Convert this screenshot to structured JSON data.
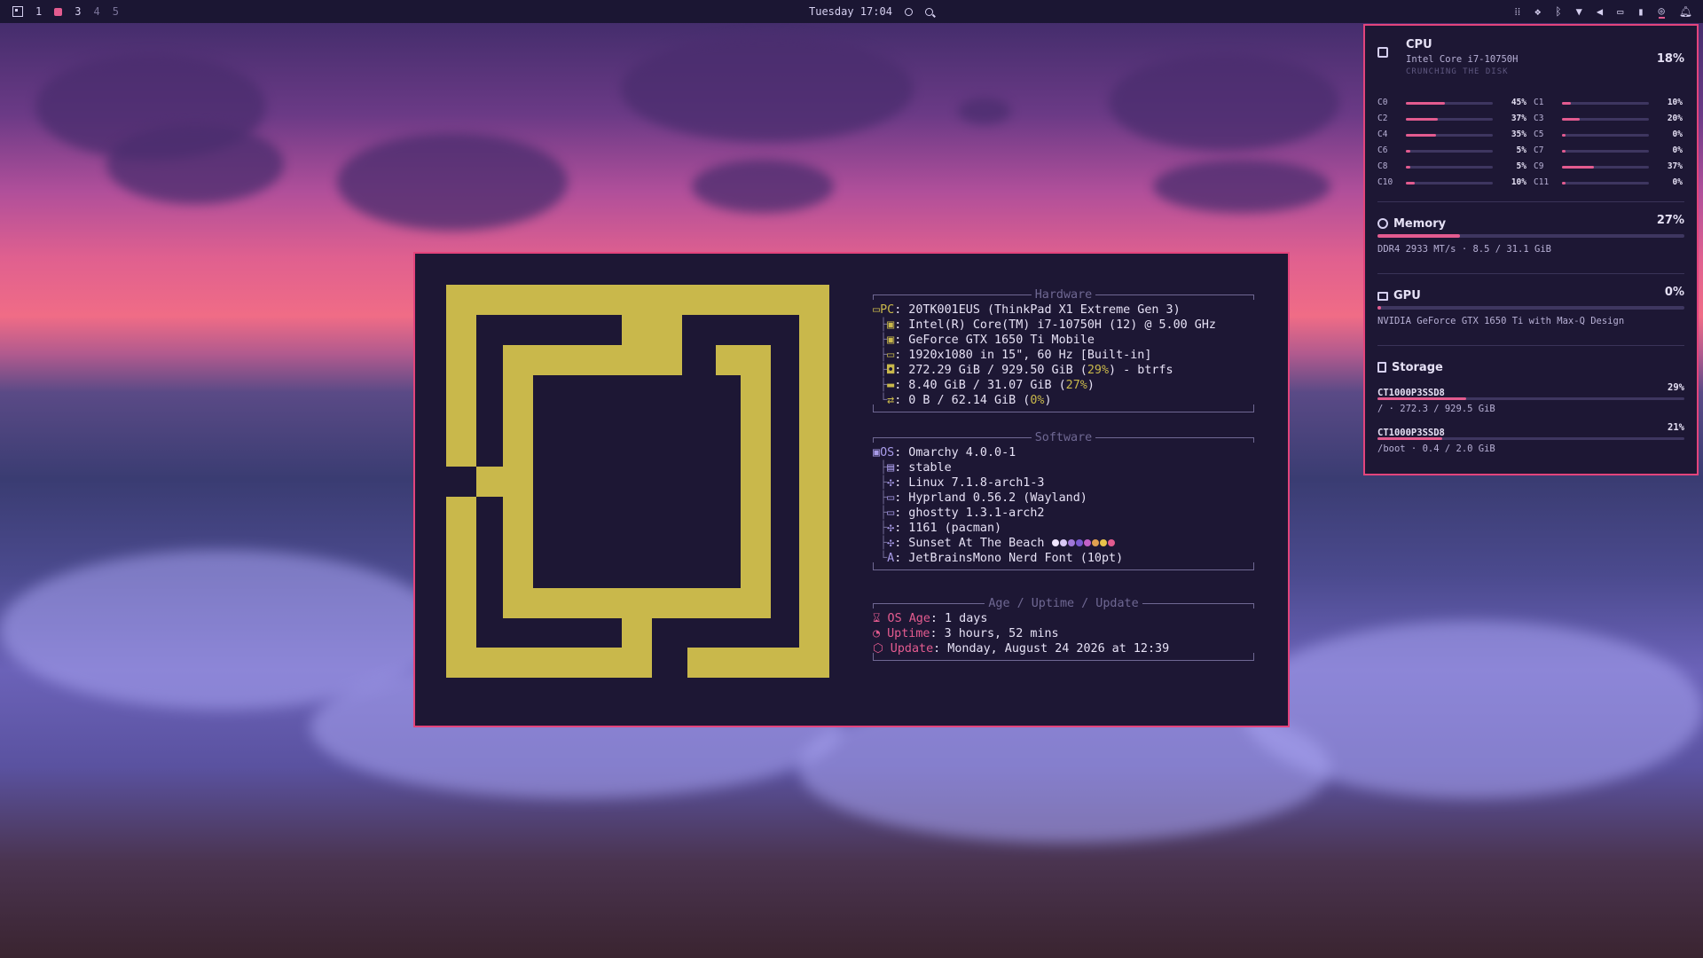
{
  "topbar": {
    "workspaces": [
      "1",
      "3",
      "4",
      "5"
    ],
    "clock": "Tuesday 17:04",
    "tray_icons": [
      "grid-icon",
      "dropbox-icon",
      "bluetooth-icon",
      "wifi-icon",
      "volume-icon",
      "display-icon",
      "battery-icon",
      "power-icon",
      "bell-icon"
    ]
  },
  "fastfetch": {
    "logo_color": "#c9b84b",
    "hardware_title": "Hardware",
    "hardware": [
      {
        "key": "PC",
        "val": ": 20TK001EUS (ThinkPad X1 Extreme Gen 3)"
      },
      {
        "key": "",
        "val": ": Intel(R) Core(TM) i7-10750H (12) @ 5.00 GHz"
      },
      {
        "key": "",
        "val": ": GeForce GTX 1650 Ti Mobile"
      },
      {
        "key": "",
        "val": ": 1920x1080 in 15\", 60 Hz [Built-in]"
      },
      {
        "key": "",
        "val_a": ": 272.29 GiB / 929.50 GiB (",
        "pct": "29%",
        "val_b": ") - btrfs"
      },
      {
        "key": "",
        "val_a": ": 8.40 GiB / 31.07 GiB (",
        "pct": "27%",
        "val_b": ")"
      },
      {
        "key": "",
        "val_a": ": 0 B / 62.14 GiB (",
        "pct": "0%",
        "val_b": ")"
      }
    ],
    "software_title": "Software",
    "software": [
      {
        "key": "OS",
        "val": ": Omarchy 4.0.0-1"
      },
      {
        "key": "",
        "val": ": stable"
      },
      {
        "key": "",
        "val": ": Linux 7.1.8-arch1-3"
      },
      {
        "key": "",
        "val": ": Hyprland 0.56.2 (Wayland)"
      },
      {
        "key": "",
        "val": ": ghostty 1.3.1-arch2"
      },
      {
        "key": "",
        "val": ": 1161 (pacman)"
      },
      {
        "key": "",
        "val": ": Sunset At The Beach"
      },
      {
        "key": "A",
        "val": ": JetBrainsMono Nerd Font (10pt)"
      }
    ],
    "theme_swatches": [
      "#f0e6ff",
      "#d9c8f5",
      "#a077d8",
      "#7a5ad0",
      "#c260c8",
      "#e0a050",
      "#e8c24a",
      "#e35b8f"
    ],
    "age_title": "Age / Uptime / Update",
    "age": [
      {
        "key": "OS Age",
        "val": ": 1 days"
      },
      {
        "key": "Uptime",
        "val": ": 3 hours, 52 mins"
      },
      {
        "key": "Update",
        "val": ": Monday, August 24 2026 at 12:39"
      }
    ]
  },
  "panel": {
    "cpu": {
      "title": "CPU",
      "model": "Intel Core i7-10750H",
      "status": "CRUNCHING THE DISK",
      "usage": "18%",
      "cores": [
        {
          "label": "C0",
          "value": "45%",
          "pct": 45
        },
        {
          "label": "C1",
          "value": "10%",
          "pct": 10
        },
        {
          "label": "C2",
          "value": "37%",
          "pct": 37
        },
        {
          "label": "C3",
          "value": "20%",
          "pct": 20
        },
        {
          "label": "C4",
          "value": "35%",
          "pct": 35
        },
        {
          "label": "C5",
          "value": "0%",
          "pct": 0
        },
        {
          "label": "C6",
          "value": "5%",
          "pct": 5
        },
        {
          "label": "C7",
          "value": "0%",
          "pct": 0
        },
        {
          "label": "C8",
          "value": "5%",
          "pct": 5
        },
        {
          "label": "C9",
          "value": "37%",
          "pct": 37
        },
        {
          "label": "C10",
          "value": "10%",
          "pct": 10
        },
        {
          "label": "C11",
          "value": "0%",
          "pct": 0
        }
      ]
    },
    "memory": {
      "title": "Memory",
      "usage": "27%",
      "pct": 27,
      "detail": "DDR4 2933 MT/s · 8.5 / 31.1 GiB"
    },
    "gpu": {
      "title": "GPU",
      "usage": "0%",
      "pct": 0,
      "detail": "NVIDIA GeForce GTX 1650 Ti with Max-Q Design"
    },
    "storage": {
      "title": "Storage",
      "disks": [
        {
          "name": "CT1000P3SSD8",
          "usage": "29%",
          "pct": 29,
          "detail": "/ · 272.3 / 929.5 GiB"
        },
        {
          "name": "CT1000P3SSD8",
          "usage": "21%",
          "pct": 21,
          "detail": "/boot · 0.4 / 2.0 GiB"
        }
      ]
    },
    "accent": "#e35b8f"
  }
}
